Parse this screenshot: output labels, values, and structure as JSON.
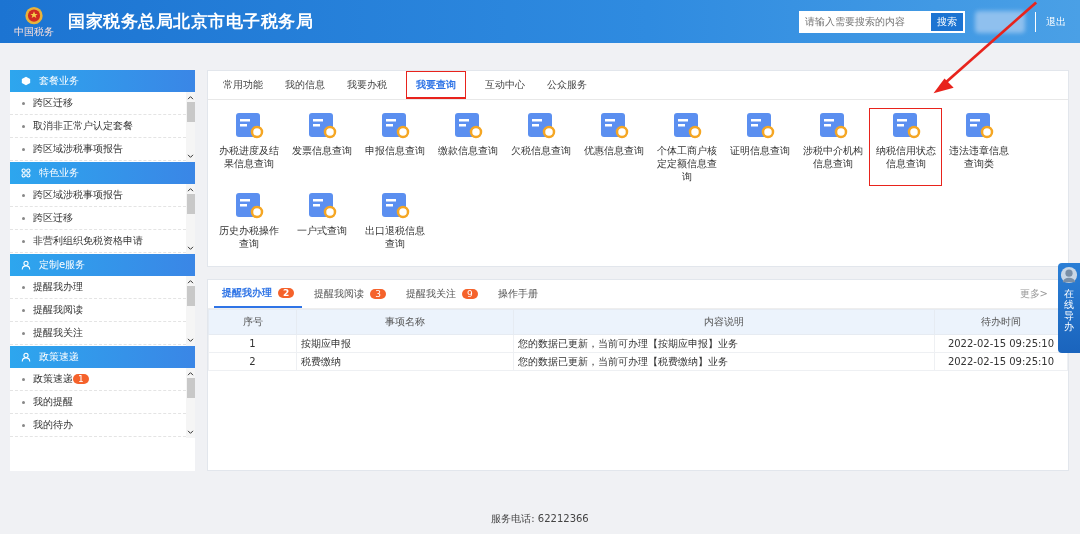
{
  "header": {
    "title": "国家税务总局北京市电子税务局",
    "logo_text": "中国税务",
    "search": {
      "placeholder": "请输入需要搜索的内容",
      "button": "搜索"
    },
    "logout": "退出"
  },
  "sidebar": {
    "sections": [
      {
        "title": "套餐业务",
        "kind": "package",
        "items": [
          {
            "label": "跨区迁移"
          },
          {
            "label": "取消非正常户认定套餐"
          },
          {
            "label": "跨区域涉税事项报告"
          }
        ]
      },
      {
        "title": "特色业务",
        "kind": "grid",
        "items": [
          {
            "label": "跨区域涉税事项报告"
          },
          {
            "label": "跨区迁移"
          },
          {
            "label": "非营利组织免税资格申请"
          }
        ]
      },
      {
        "title": "定制e服务",
        "kind": "person",
        "items": [
          {
            "label": "提醒我办理"
          },
          {
            "label": "提醒我阅读"
          },
          {
            "label": "提醒我关注"
          }
        ]
      },
      {
        "title": "政策速递",
        "kind": "person",
        "items": [
          {
            "label": "政策速递",
            "badge": "1"
          },
          {
            "label": "我的提醒"
          },
          {
            "label": "我的待办"
          }
        ]
      }
    ]
  },
  "main_tabs": [
    {
      "label": "常用功能",
      "selected": false,
      "highlighted": false
    },
    {
      "label": "我的信息",
      "selected": false,
      "highlighted": false
    },
    {
      "label": "我要办税",
      "selected": false,
      "highlighted": false
    },
    {
      "label": "我要查询",
      "selected": true,
      "highlighted": true
    },
    {
      "label": "互动中心",
      "selected": false,
      "highlighted": false
    },
    {
      "label": "公众服务",
      "selected": false,
      "highlighted": false
    }
  ],
  "functions": [
    {
      "label": "办税进度及结果信息查询",
      "highlighted": false
    },
    {
      "label": "发票信息查询",
      "highlighted": false
    },
    {
      "label": "申报信息查询",
      "highlighted": false
    },
    {
      "label": "缴款信息查询",
      "highlighted": false
    },
    {
      "label": "欠税信息查询",
      "highlighted": false
    },
    {
      "label": "优惠信息查询",
      "highlighted": false
    },
    {
      "label": "个体工商户核定定额信息查询",
      "highlighted": false
    },
    {
      "label": "证明信息查询",
      "highlighted": false
    },
    {
      "label": "涉税中介机构信息查询",
      "highlighted": false
    },
    {
      "label": "纳税信用状态信息查询",
      "highlighted": true
    },
    {
      "label": "违法违章信息查询类",
      "highlighted": false
    },
    {
      "label": "历史办税操作查询",
      "highlighted": false
    },
    {
      "label": "一户式查询",
      "highlighted": false
    },
    {
      "label": "出口退税信息查询",
      "highlighted": false
    }
  ],
  "reminder_tabs": [
    {
      "label": "提醒我办理",
      "badge": "2",
      "selected": true
    },
    {
      "label": "提醒我阅读",
      "badge": "3",
      "selected": false
    },
    {
      "label": "提醒我关注",
      "badge": "9",
      "selected": false
    },
    {
      "label": "操作手册",
      "selected": false
    }
  ],
  "more_link": "更多>",
  "table": {
    "columns": [
      "序号",
      "事项名称",
      "内容说明",
      "待办时间"
    ],
    "rows": [
      [
        "1",
        "按期应申报",
        "您的数据已更新，当前可办理【按期应申报】业务",
        "2022-02-15 09:25:10"
      ],
      [
        "2",
        "税费缴纳",
        "您的数据已更新，当前可办理【税费缴纳】业务",
        "2022-02-15 09:25:10"
      ]
    ]
  },
  "online_guide": "在线导办",
  "footer": "服务电话: 62212366"
}
